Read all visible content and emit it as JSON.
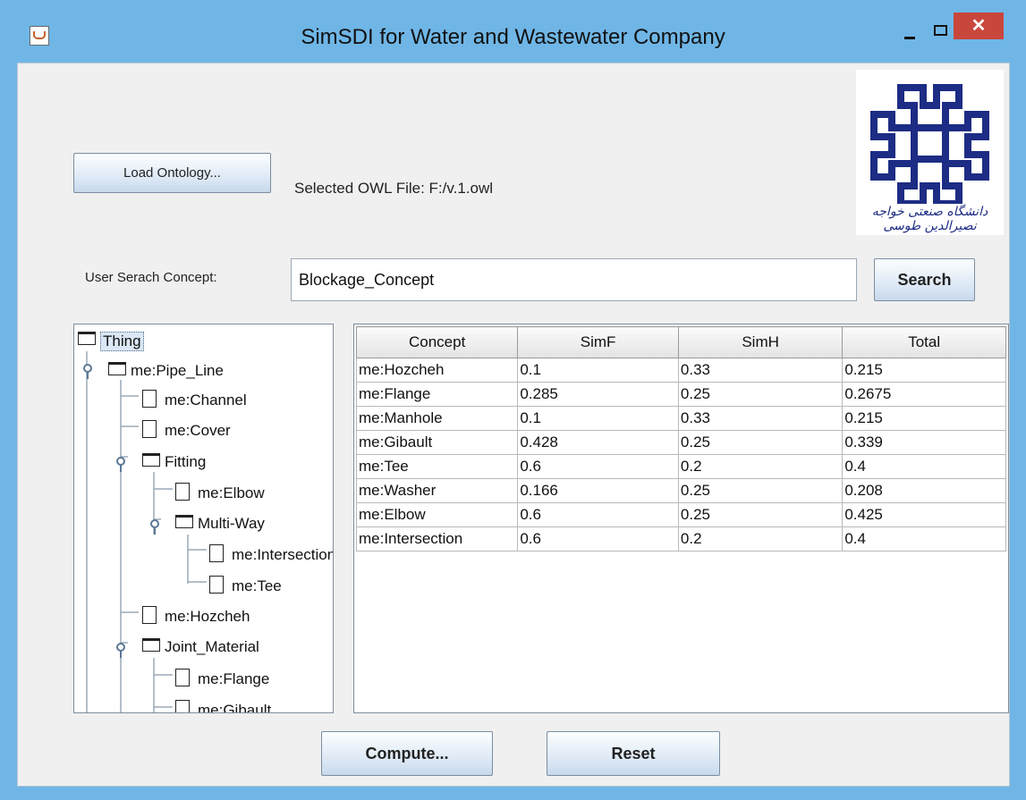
{
  "window": {
    "title": "SimSDI for Water and Wastewater Company",
    "close_label": "✕"
  },
  "toolbar": {
    "load_label": "Load Ontology...",
    "owl_file_label": "Selected OWL File: F:/v.1.owl"
  },
  "logo": {
    "caption": "دانشگاه صنعتی خواجه نصیرالدین طوسی"
  },
  "search": {
    "label": "User Serach Concept:",
    "value": "Blockage_Concept",
    "button_label": "Search"
  },
  "tree": {
    "nodes": [
      {
        "label": "Thing"
      },
      {
        "label": "me:Pipe_Line"
      },
      {
        "label": "me:Channel"
      },
      {
        "label": "me:Cover"
      },
      {
        "label": "Fitting"
      },
      {
        "label": "me:Elbow"
      },
      {
        "label": "Multi-Way"
      },
      {
        "label": "me:Intersection"
      },
      {
        "label": "me:Tee"
      },
      {
        "label": "me:Hozcheh"
      },
      {
        "label": "Joint_Material"
      },
      {
        "label": "me:Flange"
      },
      {
        "label": "me:Gibault"
      }
    ]
  },
  "table": {
    "columns": [
      "Concept",
      "SimF",
      "SimH",
      "Total"
    ],
    "rows": [
      [
        "me:Hozcheh",
        "0.1",
        "0.33",
        "0.215"
      ],
      [
        "me:Flange",
        "0.285",
        "0.25",
        "0.2675"
      ],
      [
        "me:Manhole",
        "0.1",
        "0.33",
        "0.215"
      ],
      [
        "me:Gibault",
        "0.428",
        "0.25",
        "0.339"
      ],
      [
        "me:Tee",
        "0.6",
        "0.2",
        "0.4"
      ],
      [
        "me:Washer",
        "0.166",
        "0.25",
        "0.208"
      ],
      [
        "me:Elbow",
        "0.6",
        "0.25",
        "0.425"
      ],
      [
        "me:Intersection",
        "0.6",
        "0.2",
        "0.4"
      ]
    ]
  },
  "actions": {
    "compute_label": "Compute...",
    "reset_label": "Reset"
  }
}
